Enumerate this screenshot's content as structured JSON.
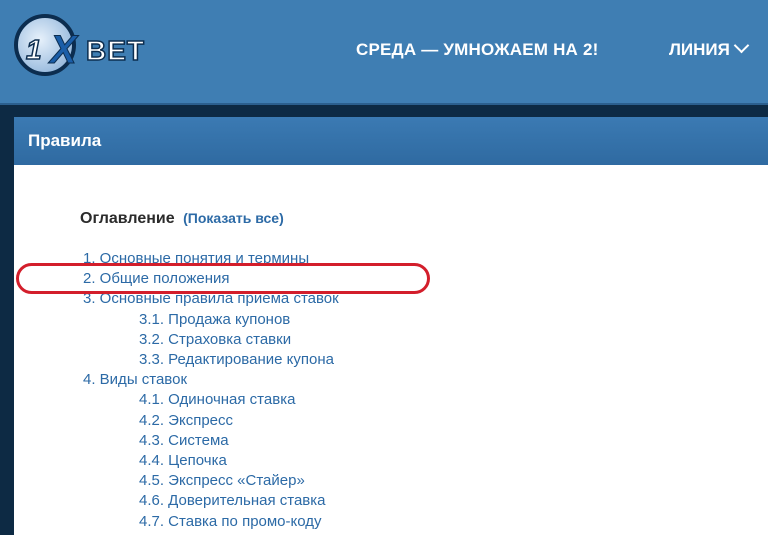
{
  "header": {
    "logo_text": "1XBET",
    "promo_label": "СРЕДА — УМНОЖАЕМ НА 2!",
    "line_label": "ЛИНИЯ"
  },
  "panel": {
    "title": "Правила"
  },
  "toc": {
    "heading": "Оглавление",
    "show_all": "(Показать все)",
    "items": [
      {
        "label": "1. Основные понятия и термины",
        "level": 1
      },
      {
        "label": "2. Общие положения",
        "level": 1
      },
      {
        "label": "3. Основные правила приема ставок",
        "level": 1
      },
      {
        "label": "3.1. Продажа купонов",
        "level": 2
      },
      {
        "label": "3.2. Страховка ставки",
        "level": 2
      },
      {
        "label": "3.3. Редактирование купона",
        "level": 2
      },
      {
        "label": "4. Виды ставок",
        "level": 1
      },
      {
        "label": "4.1. Одиночная ставка",
        "level": 2
      },
      {
        "label": "4.2. Экспресс",
        "level": 2
      },
      {
        "label": "4.3. Система",
        "level": 2
      },
      {
        "label": "4.4. Цепочка",
        "level": 2
      },
      {
        "label": "4.5. Экспресс «Стайер»",
        "level": 2
      },
      {
        "label": "4.6. Доверительная ставка",
        "level": 2
      },
      {
        "label": "4.7. Ставка по промо-коду",
        "level": 2
      }
    ]
  },
  "colors": {
    "header_bg": "#3f7eb3",
    "link": "#2c6aa6",
    "highlight": "#d31e2b"
  }
}
